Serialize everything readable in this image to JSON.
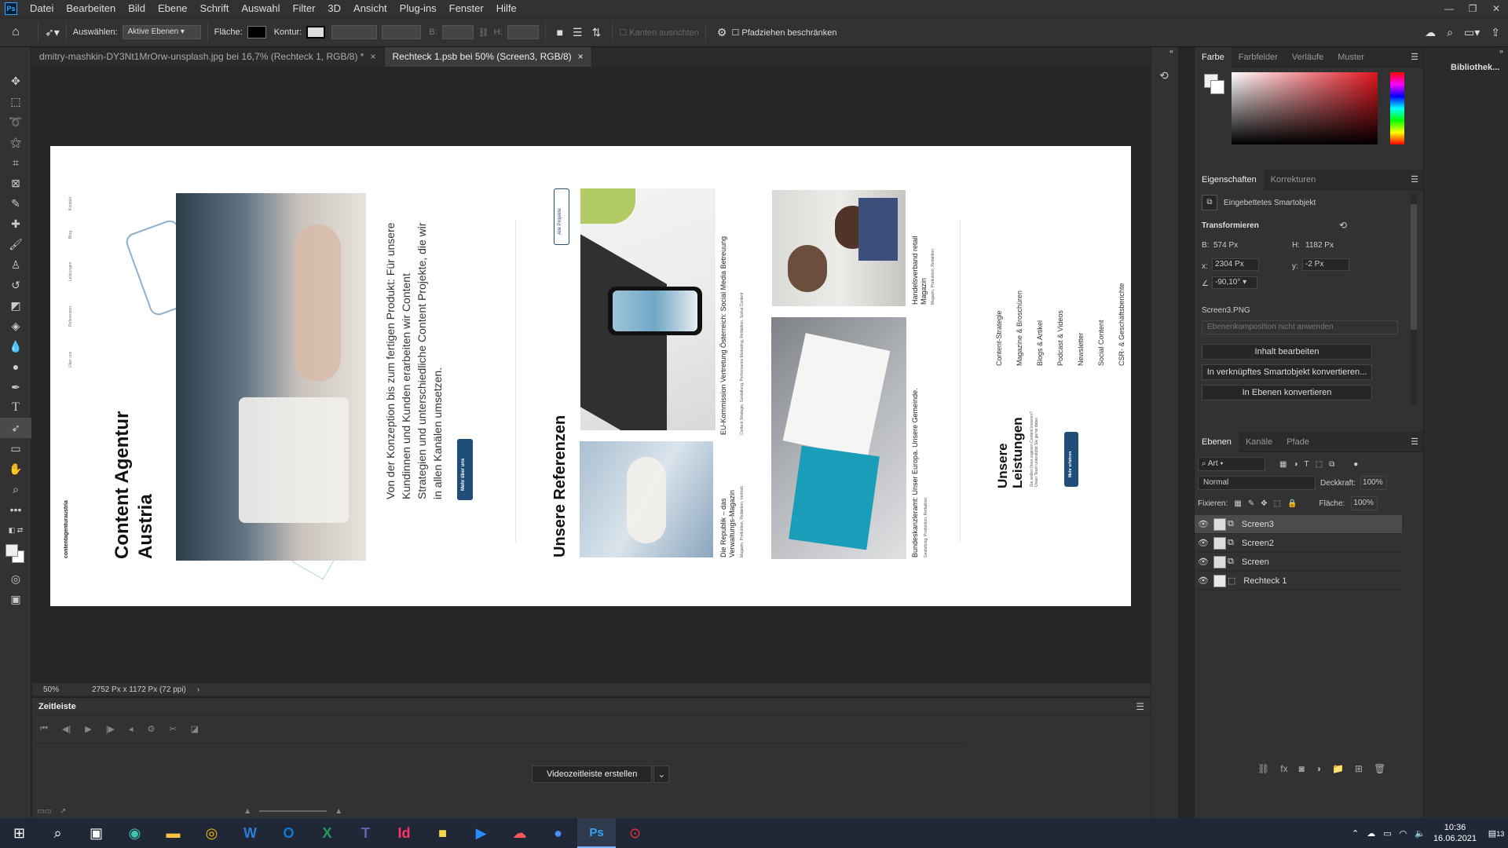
{
  "menubar": {
    "items": [
      "Datei",
      "Bearbeiten",
      "Bild",
      "Ebene",
      "Schrift",
      "Auswahl",
      "Filter",
      "3D",
      "Ansicht",
      "Plug-ins",
      "Fenster",
      "Hilfe"
    ]
  },
  "optbar": {
    "auswaehlen_label": "Auswählen:",
    "auswaehlen_value": "Aktive Ebenen",
    "flaeche_label": "Fläche:",
    "kontur_label": "Kontur:",
    "b_label": "B:",
    "h_label": "H:",
    "kanten_label": "Kanten ausrichten",
    "pfad_label": "Pfadziehen beschränken"
  },
  "tabs": [
    {
      "label": "dmitry-mashkin-DY3Nt1MrOrw-unsplash.jpg bei 16,7% (Rechteck 1, RGB/8) *"
    },
    {
      "label": "Rechteck 1.psb bei 50% (Screen3, RGB/8)"
    }
  ],
  "status": {
    "zoom": "50%",
    "info": "2752 Px x 1172 Px (72 ppi)"
  },
  "timeline": {
    "title": "Zeitleiste",
    "create_button": "Videozeitleiste erstellen"
  },
  "color_panel": {
    "tabs": [
      "Farbe",
      "Farbfelder",
      "Verläufe",
      "Muster"
    ]
  },
  "properties": {
    "tabs": [
      "Eigenschaften",
      "Korrekturen"
    ],
    "type": "Eingebettetes Smartobjekt",
    "transform_title": "Transformieren",
    "w_label": "B:",
    "w_value": "574 Px",
    "h_label": "H:",
    "h_value": "1182 Px",
    "x_label": "x:",
    "x_value": "2304 Px",
    "y_label": "y:",
    "y_value": "-2 Px",
    "angle_value": "-90,10°",
    "filename": "Screen3.PNG",
    "comp_placeholder": "Ebenenkomposition nicht anwenden",
    "btn_edit": "Inhalt bearbeiten",
    "btn_convert_linked": "In verknüpftes Smartobjekt konvertieren...",
    "btn_convert_layers": "In Ebenen konvertieren"
  },
  "layers": {
    "tabs": [
      "Ebenen",
      "Kanäle",
      "Pfade"
    ],
    "filter_kind": "Art",
    "blend_mode": "Normal",
    "opacity_label": "Deckkraft:",
    "opacity_value": "100%",
    "lock_label": "Fixieren:",
    "fill_label": "Fläche:",
    "fill_value": "100%",
    "items": [
      {
        "name": "Screen3",
        "active": true
      },
      {
        "name": "Screen2",
        "active": false
      },
      {
        "name": "Screen",
        "active": false
      },
      {
        "name": "Rechteck 1",
        "active": false
      }
    ]
  },
  "library": {
    "label": "Bibliothek..."
  },
  "artboard": {
    "brand": "contentagenturaustria",
    "nav": [
      "Kontakt",
      "Blog",
      "Leistungen",
      "Referenzen",
      "Über uns"
    ],
    "hero_title_1": "Content Agentur",
    "hero_title_2": "Austria",
    "intro_text": [
      "Von der Konzeption bis zum fertigen Produkt: Für unsere",
      "Kundinnen und Kunden erarbeiten wir Content",
      "Strategien und unterschiedliche Content Projekte, die wir",
      "in allen Kanälen umsetzen."
    ],
    "intro_button": "Mehr über uns",
    "ref_title": "Unsere Referenzen",
    "ref_button": "Alle Projekte",
    "ref1_title": "EU-Kommission Vertretung Österreich: Social Media Betreuung",
    "ref1_tags": "Content Strategie, Gestaltung, Performance Marketing, Redaktion, Social Content",
    "ref2_title": "Die Republik – das Verwaltungs-Magazin",
    "ref2_tags": "Magazin, Produktion, Redaktion, Vertrieb",
    "ref3_title": "Handelsverband retail Magazin",
    "ref3_tags": "Magazin, Produktion, Redaktion",
    "ref4_title": "Bundeskanzleramt: Unser Europa. Unsere Gemeinde.",
    "ref4_tags": "Gestaltung, Produktion, Redaktion",
    "services_title_1": "Unsere",
    "services_title_2": "Leistungen",
    "services_text": "Sie wollen Ihren eigenen Content kreieren? Unser Team unterstützt Sie gerne dabei.",
    "services_button": "Mehr erfahren",
    "services_list": [
      "Content-Strategie",
      "Magazine & Broschüren",
      "Blogs & Artikel",
      "Podcast & Videos",
      "Newsletter",
      "Social Content",
      "CSR- & Geschäftsberichte"
    ]
  },
  "taskbar": {
    "time": "10:36",
    "date": "16.06.2021",
    "notifications": "13"
  },
  "colors": {
    "accent": "#1f4e79",
    "ui_bg": "#323232",
    "canvas_bg": "#262626"
  }
}
